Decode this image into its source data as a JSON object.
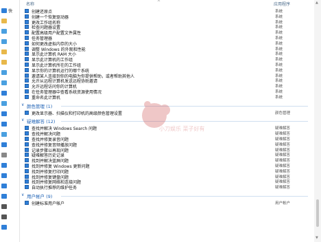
{
  "nav": {
    "items": [
      {
        "label": "快",
        "color": "#2f7fd8"
      },
      {
        "label": "",
        "color": "#e8b84a"
      },
      {
        "label": "",
        "color": "#4aa0e0"
      },
      {
        "label": "",
        "color": "#4aa0e0"
      },
      {
        "label": "",
        "color": "#e8b84a"
      },
      {
        "label": "",
        "color": "#e8b84a"
      },
      {
        "label": "",
        "color": "#4aa0e0"
      },
      {
        "label": "",
        "color": "#4aa0e0"
      },
      {
        "label": "",
        "color": "#2f7fd8"
      },
      {
        "label": "",
        "color": "#4aa0e0"
      },
      {
        "label": "",
        "color": "#2f7fd8"
      },
      {
        "label": "",
        "color": "#2f7fd8"
      },
      {
        "label": "",
        "color": "#4aa0e0"
      },
      {
        "label": "",
        "color": "#2f7fd8"
      },
      {
        "label": "",
        "color": "#888888"
      },
      {
        "label": "",
        "color": "#2f7fd8"
      },
      {
        "label": "",
        "color": "#2f7fd8"
      },
      {
        "label": "",
        "color": "#2f7fd8"
      },
      {
        "label": "",
        "color": "#2f7fd8"
      },
      {
        "label": "",
        "color": "#555555"
      },
      {
        "label": "",
        "color": "#555555"
      },
      {
        "label": "",
        "color": "#2f7fd8"
      }
    ]
  },
  "columns": {
    "name": "名称",
    "app": "应用程序",
    "sort": "^"
  },
  "rows_top": [
    {
      "name": "创建还原点",
      "app": "系统"
    },
    {
      "name": "创建一个恢复驱动器",
      "app": "系统"
    },
    {
      "name": "更改工作组名称",
      "app": "系统"
    },
    {
      "name": "检查问题器设置",
      "app": "系统"
    },
    {
      "name": "配置高级用户配置文件属性",
      "app": "系统"
    },
    {
      "name": "任务管理器",
      "app": "系统"
    },
    {
      "name": "如何更改虚拟内存的大小",
      "app": "系统"
    },
    {
      "name": "调整 Windows 的外观和性能",
      "app": "系统"
    },
    {
      "name": "显示此计算机 RAM 大小",
      "app": "系统"
    },
    {
      "name": "显示此计算机的工作组",
      "app": "系统"
    },
    {
      "name": "显示此计算机所在的工作组",
      "app": "系统"
    },
    {
      "name": "显示你的计算机运行的哪个系统",
      "app": "系统"
    },
    {
      "name": "邀请某人连接到你的电脑为你提供帮助，或者帮助其他人",
      "app": "系统"
    },
    {
      "name": "允许从远程计算机发送远程协助邀请",
      "app": "系统"
    },
    {
      "name": "允许远程访问你的计算机",
      "app": "系统"
    },
    {
      "name": "在任务管理器中查看系统资源使用情况",
      "app": "系统"
    },
    {
      "name": "重命名此计算机",
      "app": "系统"
    }
  ],
  "group_color": {
    "title": "颜色管理 (1)",
    "rows": [
      {
        "name": "更改显示器、扫描仪和打印机的高级颜色管理设置",
        "app": "颜色管理"
      }
    ]
  },
  "group_troubleshoot": {
    "title": "疑难解答 (12)",
    "rows": [
      {
        "name": "查找并解决 Windows Search 问题",
        "app": "疑难解答"
      },
      {
        "name": "查找并解决问题",
        "app": "疑难解答"
      },
      {
        "name": "查找并修复录音问题",
        "app": "疑难解答"
      },
      {
        "name": "查找并修复音频播放问题",
        "app": "疑难解答"
      },
      {
        "name": "记录步骤以再现问题",
        "app": "疑难解答"
      },
      {
        "name": "疑难解答历史记录",
        "app": "疑难解答"
      },
      {
        "name": "找到并解决蓝屏问题",
        "app": "疑难解答"
      },
      {
        "name": "找到并修复 Windows 更新问题",
        "app": "疑难解答"
      },
      {
        "name": "找到并修复打印问题",
        "app": "疑难解答"
      },
      {
        "name": "找到并修复键盘问题",
        "app": "疑难解答"
      },
      {
        "name": "找到并修复网络和连接问题",
        "app": "疑难解答"
      },
      {
        "name": "自动执行推荐的维护任务",
        "app": "疑难解答"
      }
    ]
  },
  "group_users": {
    "title": "用户帐户 (9)",
    "rows": [
      {
        "name": "创建标准用户帐户",
        "app": "用户帐户"
      }
    ]
  },
  "watermark": "小刀娱乐  菜子好有",
  "scroll": {
    "up": "▲",
    "down": "▼"
  }
}
